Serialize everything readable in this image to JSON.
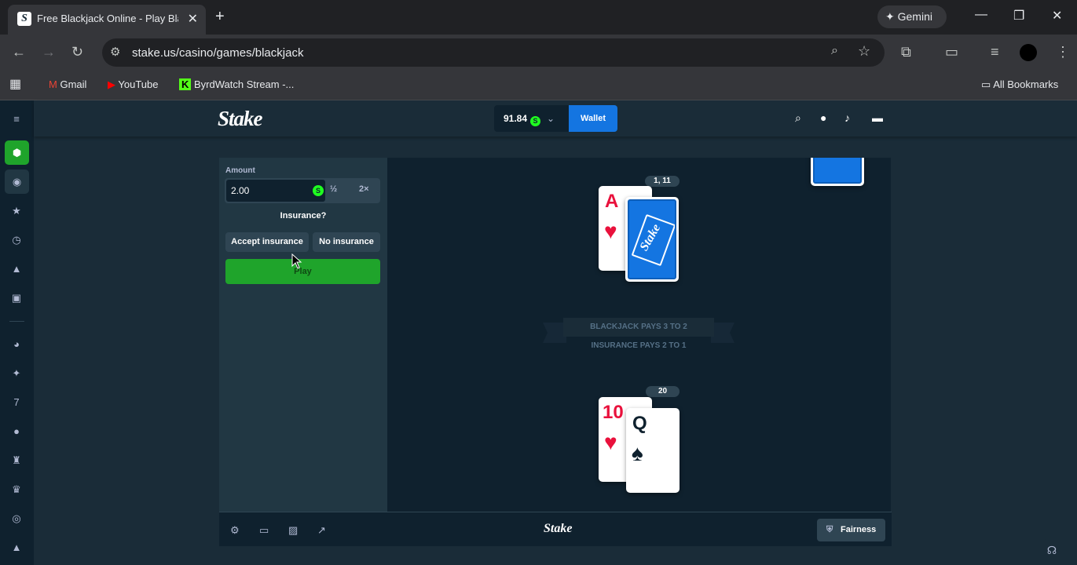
{
  "browser": {
    "tab_title": "Free Blackjack Online - Play Blackjack",
    "url": "stake.us/casino/games/blackjack",
    "gemini_label": "Gemini",
    "bookmarks": [
      "Gmail",
      "YouTube",
      "ByrdWatch Stream -..."
    ],
    "all_bookmarks": "All Bookmarks"
  },
  "header": {
    "logo": "Stake",
    "balance": "91.84",
    "currency_symbol": "S",
    "wallet_label": "Wallet"
  },
  "controls": {
    "amount_label": "Amount",
    "amount_value": "2.00",
    "currency_symbol": "S",
    "half_label": "½",
    "double_label": "2×",
    "insurance_question": "Insurance?",
    "accept_insurance": "Accept insurance",
    "no_insurance": "No insurance",
    "play_label": "Play"
  },
  "board": {
    "dealer_score": "1, 11",
    "dealer_up_card": {
      "rank": "A",
      "suit": "♥",
      "color": "red"
    },
    "player_score": "20",
    "player_cards": [
      {
        "rank": "10",
        "suit": "♥",
        "color": "red"
      },
      {
        "rank": "Q",
        "suit": "♠",
        "color": "black"
      }
    ],
    "card_back_brand": "Stake",
    "ribbon_line1": "BLACKJACK PAYS 3 TO 2",
    "ribbon_line2": "INSURANCE PAYS 2 TO 1"
  },
  "footer": {
    "logo": "Stake",
    "fairness_label": "Fairness"
  },
  "colors": {
    "background": "#1a2c38",
    "panel": "#213743",
    "board": "#0f212e",
    "accent_green": "#1fa42b",
    "wallet_blue": "#1475e1",
    "card_red": "#e9113c"
  }
}
